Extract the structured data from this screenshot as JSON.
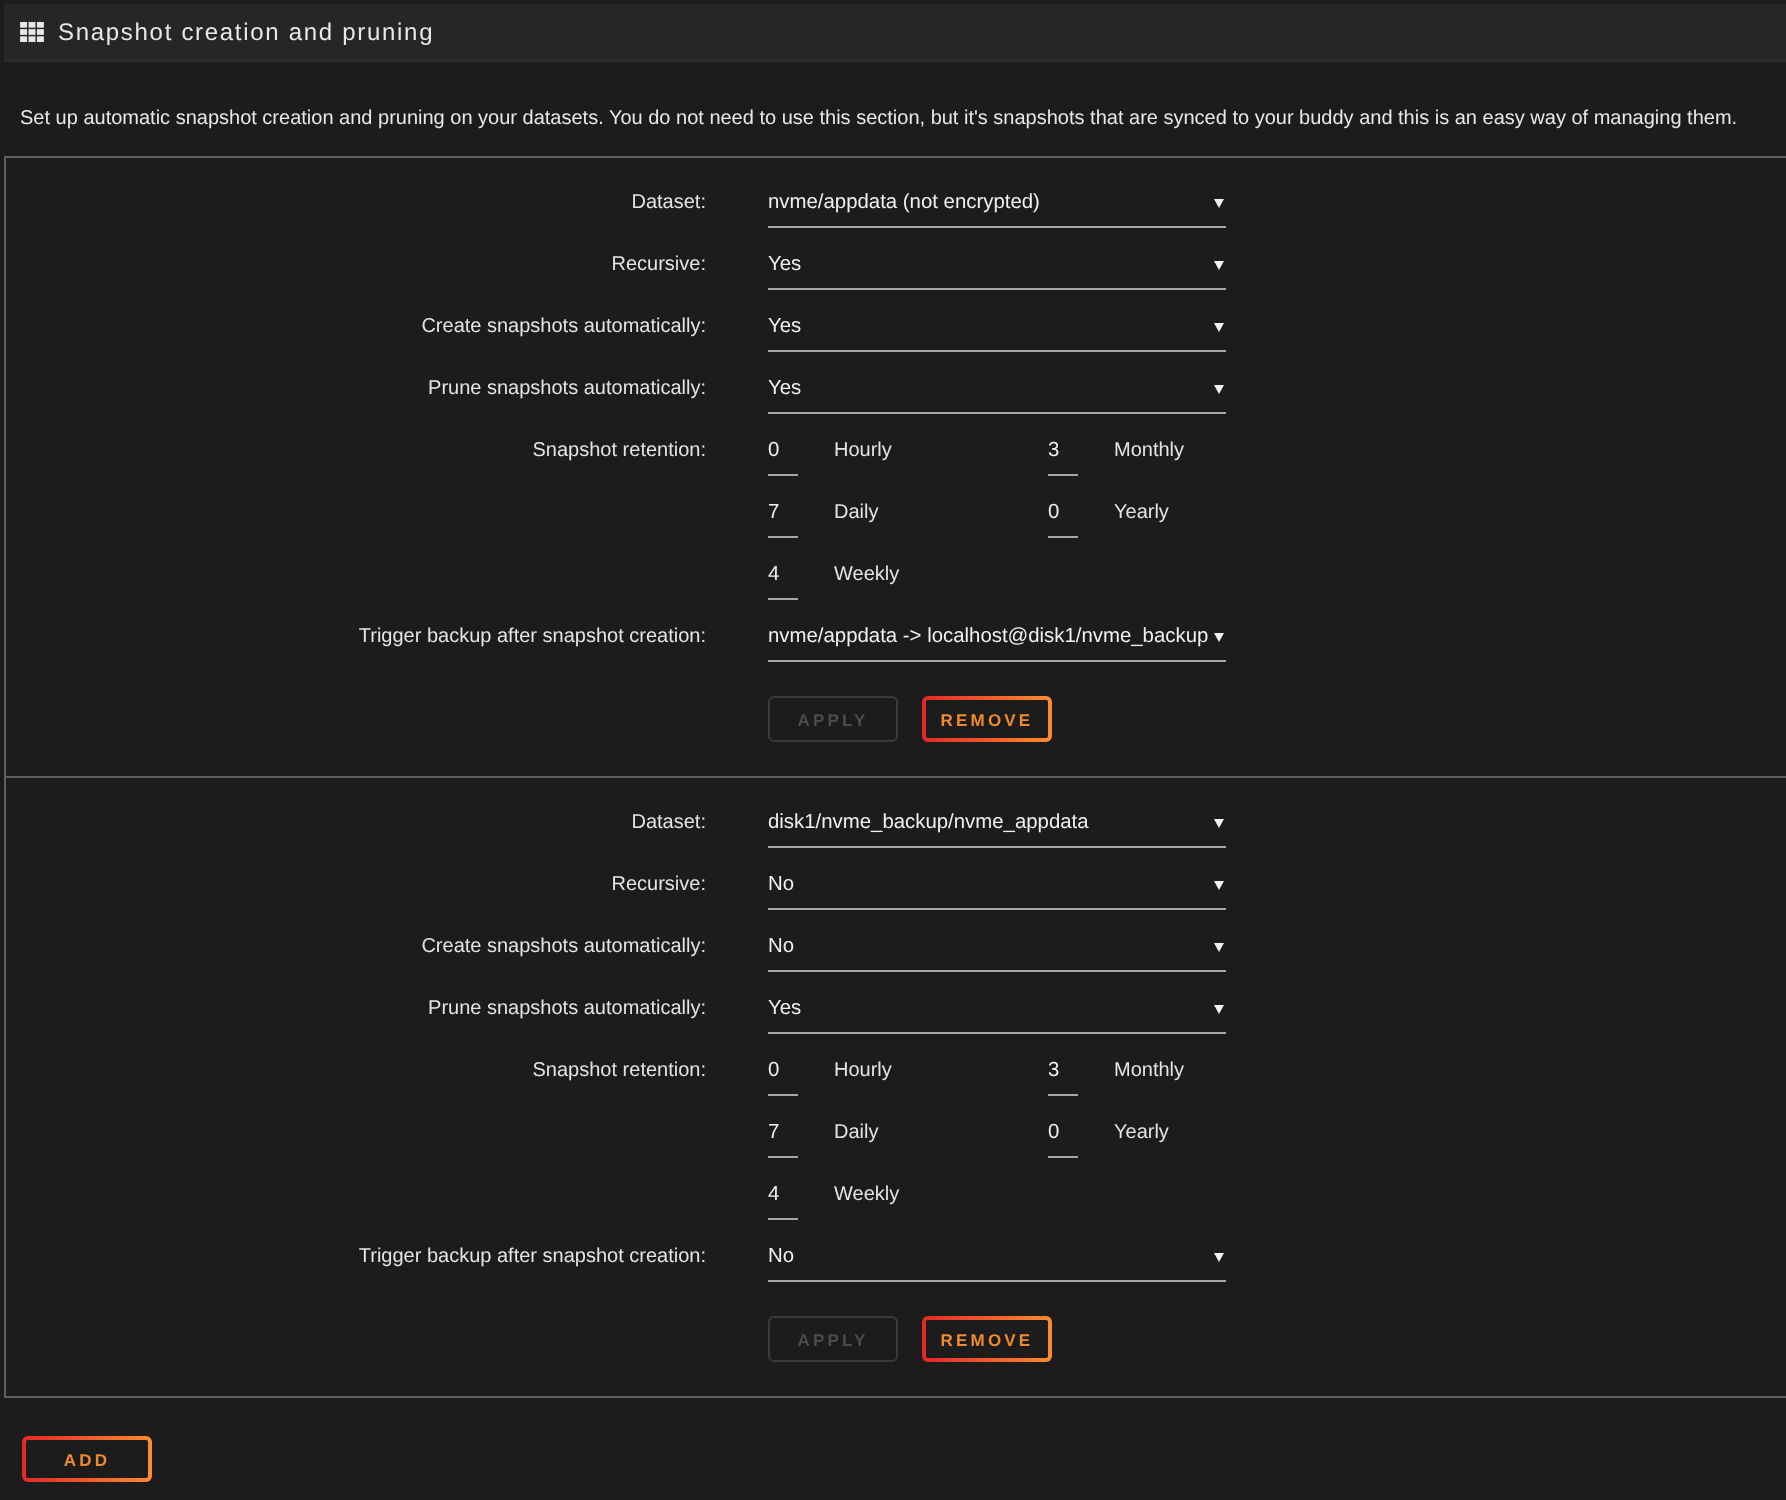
{
  "header": {
    "title": "Snapshot creation and pruning"
  },
  "description": "Set up automatic snapshot creation and pruning on your datasets. You do not need to use this section, but it's snapshots that are synced to your buddy and this is an easy way of managing them.",
  "configs": [
    {
      "rows": [
        {
          "kind": "select",
          "label": "Dataset:",
          "value": "nvme/appdata (not encrypted)"
        },
        {
          "kind": "select",
          "label": "Recursive:",
          "value": "Yes"
        },
        {
          "kind": "select",
          "label": "Create snapshots automatically:",
          "value": "Yes"
        },
        {
          "kind": "select",
          "label": "Prune snapshots automatically:",
          "value": "Yes"
        },
        {
          "kind": "retention",
          "label": "Snapshot retention:",
          "items": [
            {
              "value": "0",
              "unit": "Hourly"
            },
            {
              "value": "3",
              "unit": "Monthly"
            },
            {
              "value": "7",
              "unit": "Daily"
            },
            {
              "value": "0",
              "unit": "Yearly"
            },
            {
              "value": "4",
              "unit": "Weekly"
            }
          ]
        },
        {
          "kind": "select",
          "label": "Trigger backup after snapshot creation:",
          "value": "nvme/appdata -> localhost@disk1/nvme_backup"
        }
      ],
      "buttons": [
        {
          "label": "APPLY",
          "disabled": true
        },
        {
          "label": "REMOVE",
          "disabled": false
        }
      ]
    },
    {
      "rows": [
        {
          "kind": "select",
          "label": "Dataset:",
          "value": "disk1/nvme_backup/nvme_appdata"
        },
        {
          "kind": "select",
          "label": "Recursive:",
          "value": "No"
        },
        {
          "kind": "select",
          "label": "Create snapshots automatically:",
          "value": "No"
        },
        {
          "kind": "select",
          "label": "Prune snapshots automatically:",
          "value": "Yes"
        },
        {
          "kind": "retention",
          "label": "Snapshot retention:",
          "items": [
            {
              "value": "0",
              "unit": "Hourly"
            },
            {
              "value": "3",
              "unit": "Monthly"
            },
            {
              "value": "7",
              "unit": "Daily"
            },
            {
              "value": "0",
              "unit": "Yearly"
            },
            {
              "value": "4",
              "unit": "Weekly"
            }
          ]
        },
        {
          "kind": "select",
          "label": "Trigger backup after snapshot creation:",
          "value": "No"
        }
      ],
      "buttons": [
        {
          "label": "APPLY",
          "disabled": true
        },
        {
          "label": "REMOVE",
          "disabled": false
        }
      ]
    }
  ],
  "add_button": {
    "label": "ADD"
  }
}
